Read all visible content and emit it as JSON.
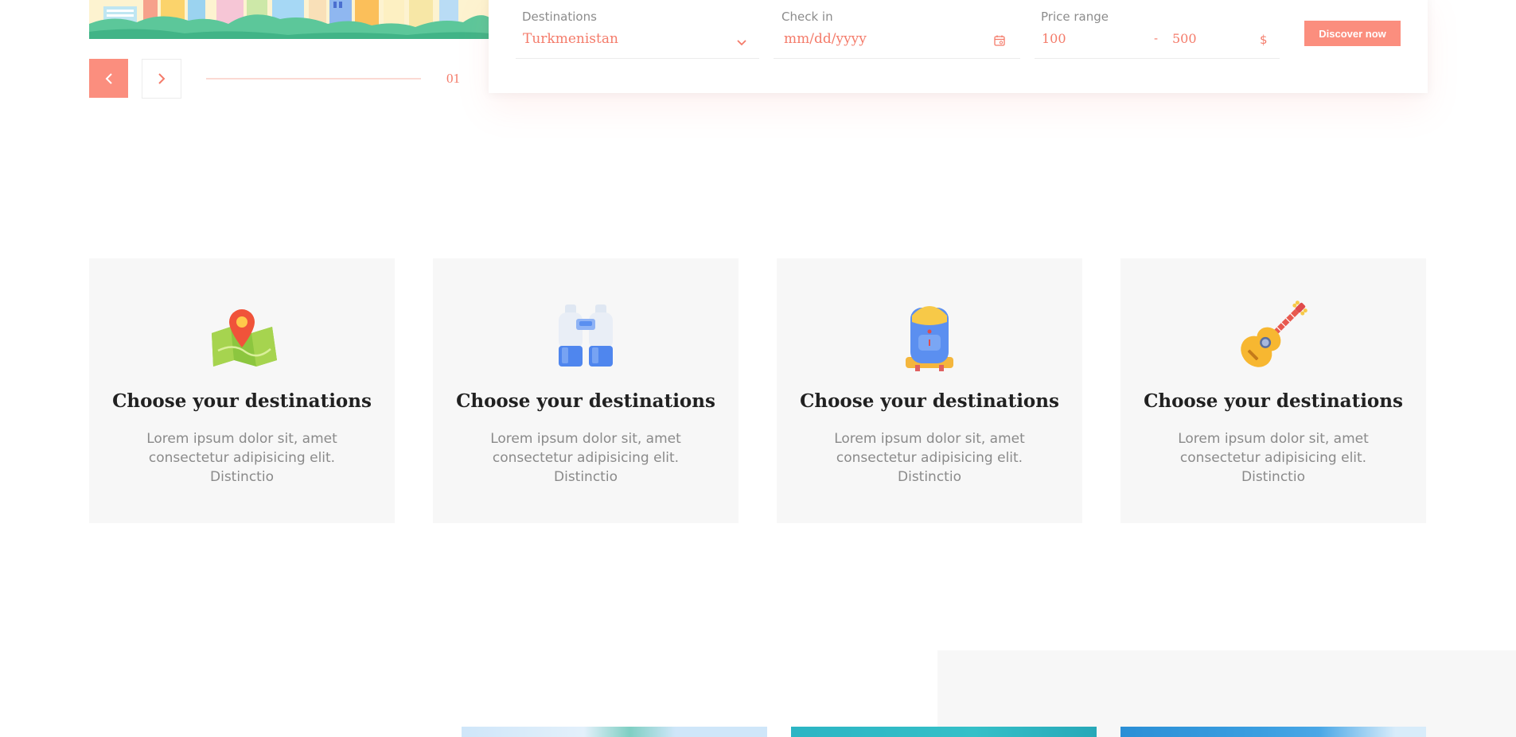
{
  "slider": {
    "prev_icon": "chevron-left-icon",
    "next_icon": "chevron-right-icon",
    "counter": "01",
    "accent": "#fb8e7e"
  },
  "search": {
    "destination": {
      "label": "Destinations",
      "value": "Turkmenistan",
      "icon": "chevron-down-icon"
    },
    "check_in": {
      "label": "Check in",
      "placeholder": "mm/dd/yyyy",
      "icon": "calendar-icon"
    },
    "price": {
      "label": "Price range",
      "min": "100",
      "separator": "-",
      "max": "500",
      "currency": "$"
    },
    "button_label": "Discover now"
  },
  "features": [
    {
      "icon": "map-pin-icon",
      "title": "Choose your destinations",
      "text": "Lorem ipsum dolor sit, amet consectetur adipisicing elit. Distinctio"
    },
    {
      "icon": "binoculars-icon",
      "title": "Choose your destinations",
      "text": "Lorem ipsum dolor sit, amet consectetur adipisicing elit. Distinctio"
    },
    {
      "icon": "backpack-icon",
      "title": "Choose your destinations",
      "text": "Lorem ipsum dolor sit, amet consectetur adipisicing elit. Distinctio"
    },
    {
      "icon": "guitar-icon",
      "title": "Choose your destinations",
      "text": "Lorem ipsum dolor sit, amet consectetur adipisicing elit. Distinctio"
    }
  ],
  "colors": {
    "accent": "#fb8e7e",
    "accent_text": "#f47b6a",
    "card_bg": "#f7f7f7"
  }
}
